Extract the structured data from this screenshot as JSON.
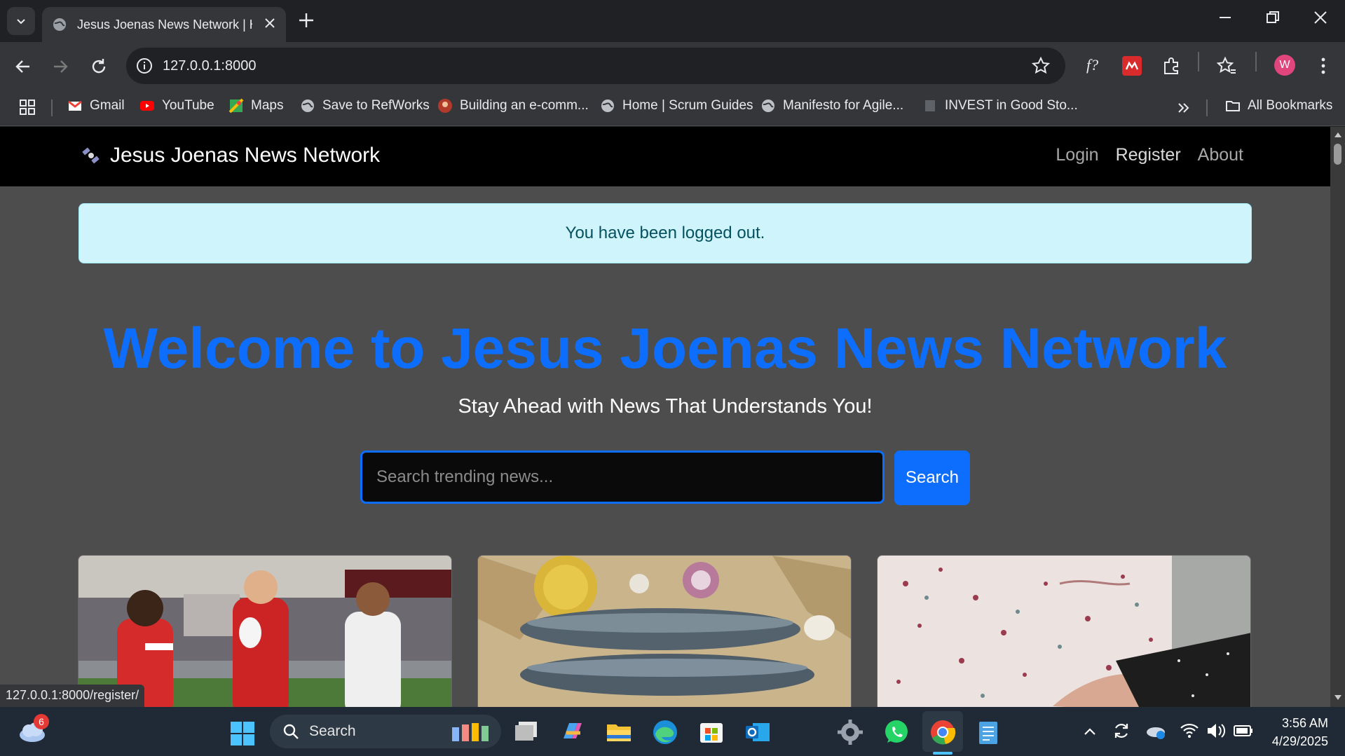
{
  "browser": {
    "tab_title": "Jesus Joenas News Network | H",
    "url": "127.0.0.1:8000",
    "profile_initial": "W",
    "bookmarks": [
      {
        "label": "Gmail"
      },
      {
        "label": "YouTube"
      },
      {
        "label": "Maps"
      },
      {
        "label": "Save to RefWorks"
      },
      {
        "label": "Building an e-comm..."
      },
      {
        "label": "Home | Scrum Guides"
      },
      {
        "label": "Manifesto for Agile..."
      },
      {
        "label": "INVEST in Good Sto..."
      }
    ],
    "all_bookmarks": "All Bookmarks",
    "status_url": "127.0.0.1:8000/register/"
  },
  "site": {
    "brand": "Jesus Joenas News Network",
    "nav": {
      "login": "Login",
      "register": "Register",
      "about": "About"
    },
    "alert": "You have been logged out.",
    "hero_title": "Welcome to Jesus Joenas News Network",
    "hero_subtitle": "Stay Ahead with News That Understands You!",
    "search": {
      "placeholder": "Search trending news...",
      "button": "Search"
    },
    "cards": [
      {
        "image": "rugby-players"
      },
      {
        "image": "mackerel-fish"
      },
      {
        "image": "elderly-hands"
      }
    ]
  },
  "taskbar": {
    "search_label": "Search",
    "weather_badge": "6",
    "time": "3:56 AM",
    "date": "4/29/2025"
  },
  "colors": {
    "primary": "#0d6efd",
    "alert_bg": "#cff4fc",
    "alert_text": "#055160",
    "page_bg": "#4d4d4d"
  }
}
